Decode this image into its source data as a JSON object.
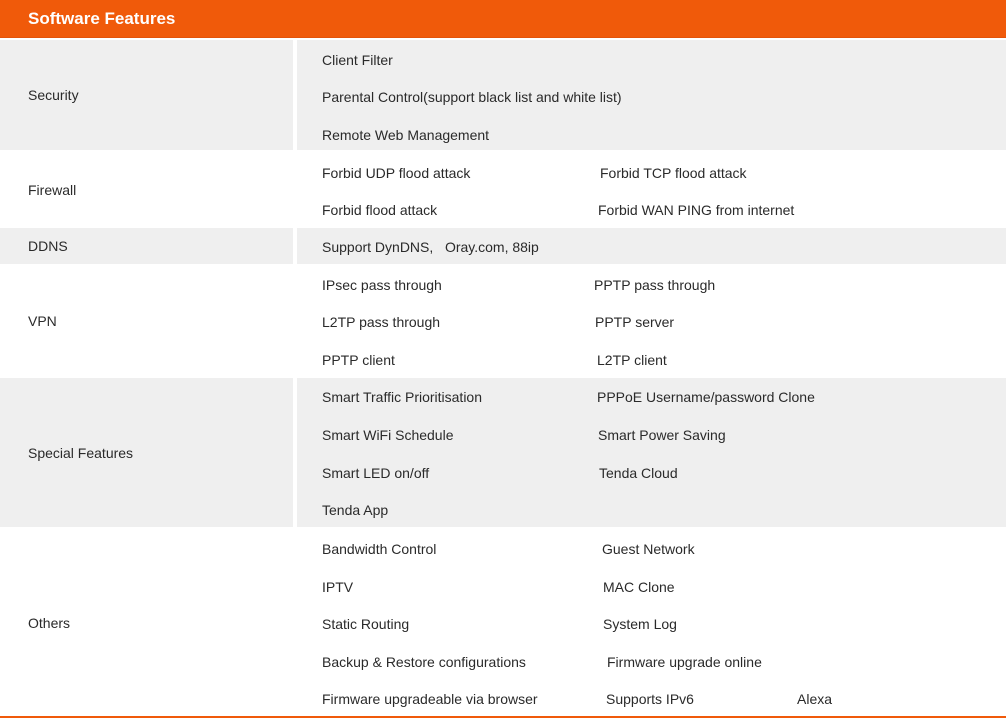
{
  "header": {
    "title": "Software Features"
  },
  "rows": {
    "security": {
      "label": "Security",
      "features": [
        "Client Filter",
        "Parental Control(support black list and white list)",
        "Remote Web Management"
      ]
    },
    "firewall": {
      "label": "Firewall",
      "features": [
        "Forbid UDP flood attack",
        "Forbid TCP flood attack",
        "Forbid flood attack",
        "Forbid WAN PING from internet"
      ]
    },
    "ddns": {
      "label": "DDNS",
      "features": [
        "Support DynDNS,   Oray.com, 88ip"
      ]
    },
    "vpn": {
      "label": "VPN",
      "features": [
        "IPsec pass through",
        "PPTP pass through",
        "L2TP pass through",
        "PPTP server",
        "PPTP client",
        "L2TP client"
      ]
    },
    "special": {
      "label": "Special Features",
      "features": [
        "Smart Traffic Prioritisation",
        "PPPoE Username/password Clone",
        "Smart WiFi Schedule",
        "Smart Power Saving",
        "Smart LED on/off",
        "Tenda Cloud",
        "Tenda App"
      ]
    },
    "others": {
      "label": "Others",
      "features": [
        "Bandwidth Control",
        "Guest Network",
        "IPTV",
        "MAC Clone",
        "Static Routing",
        "System Log",
        "Backup & Restore configurations",
        "Firmware upgrade online",
        "Firmware upgradeable via browser",
        "Supports IPv6",
        "Alexa"
      ]
    }
  },
  "colors": {
    "accent": "#f05a0a",
    "shaded_row": "#efefef",
    "text": "#2a2a2a",
    "header_text": "#ffffff"
  }
}
